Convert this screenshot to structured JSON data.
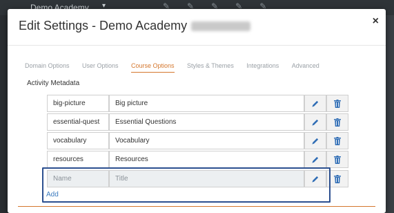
{
  "background": {
    "app_title": "Demo Academy",
    "caret": "▾"
  },
  "modal": {
    "title": "Edit Settings - Demo Academy",
    "close_label": "×",
    "tabs": [
      {
        "label": "Domain Options",
        "active": false
      },
      {
        "label": "User Options",
        "active": false
      },
      {
        "label": "Course Options",
        "active": true
      },
      {
        "label": "Styles & Themes",
        "active": false
      },
      {
        "label": "Integrations",
        "active": false
      },
      {
        "label": "Advanced",
        "active": false
      }
    ],
    "section_label": "Activity Metadata",
    "rows": [
      {
        "key": "big-picture",
        "title": "Big picture"
      },
      {
        "key": "essential-quest",
        "title": "Essential Questions"
      },
      {
        "key": "vocabulary",
        "title": "Vocabulary"
      },
      {
        "key": "resources",
        "title": "Resources"
      }
    ],
    "new_row": {
      "key_placeholder": "Name",
      "title_placeholder": "Title"
    },
    "add_label": "Add"
  },
  "colors": {
    "accent": "#d4762c",
    "link": "#3b7bbf",
    "icon": "#2f6db5",
    "highlight": "#2b4f8f"
  }
}
